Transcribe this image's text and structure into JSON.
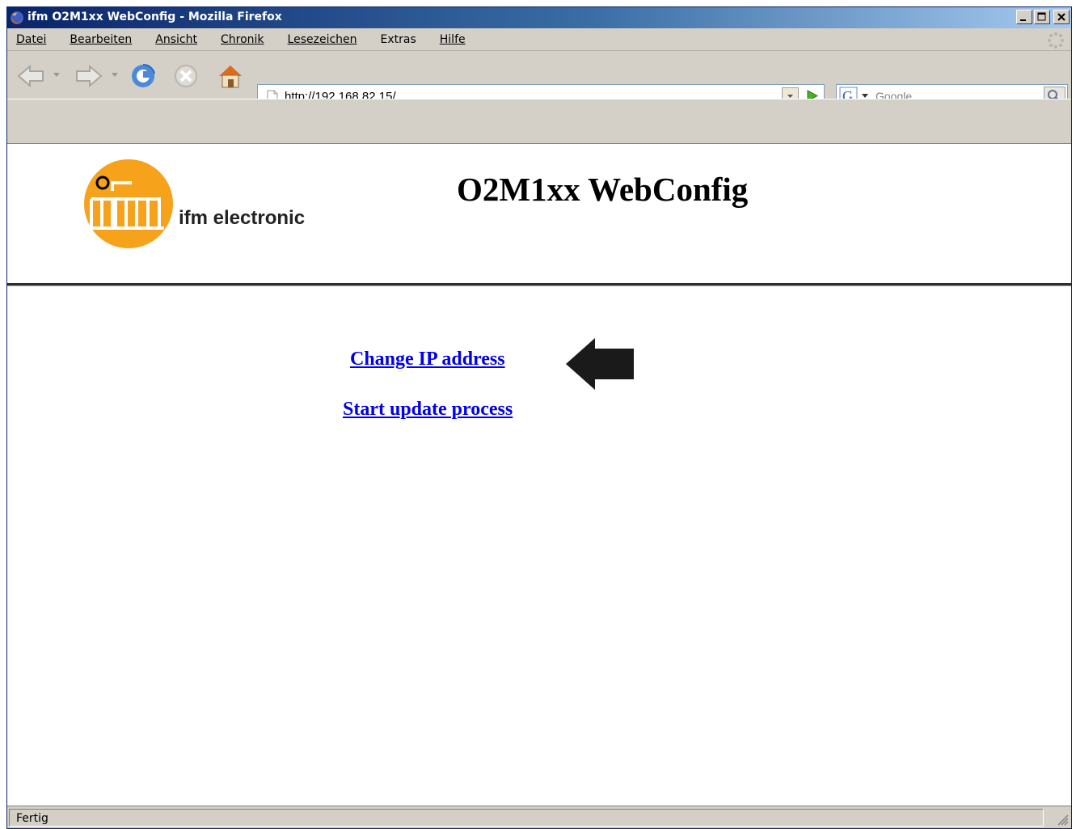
{
  "window": {
    "title": "ifm O2M1xx WebConfig - Mozilla Firefox",
    "controls": [
      "minimize-icon",
      "maximize-icon",
      "close-icon"
    ]
  },
  "menu": {
    "items": [
      {
        "label": "Datei",
        "accel": "D"
      },
      {
        "label": "Bearbeiten",
        "accel": "B"
      },
      {
        "label": "Ansicht",
        "accel": "A"
      },
      {
        "label": "Chronik",
        "accel": "C"
      },
      {
        "label": "Lesezeichen",
        "accel": "L"
      },
      {
        "label": "Extras",
        "accel": "x"
      },
      {
        "label": "Hilfe",
        "accel": "H"
      }
    ]
  },
  "navigation": {
    "url": "http://192.168.82.15/",
    "search_placeholder": "Google",
    "icons": [
      "back-icon",
      "forward-icon",
      "reload-icon",
      "stop-icon",
      "home-icon"
    ]
  },
  "page": {
    "brand": "ifm electronic",
    "title": "O2M1xx WebConfig",
    "links": {
      "change_ip": "Change IP address",
      "start_update": "Start update process"
    }
  },
  "status": {
    "text": "Fertig"
  },
  "colors": {
    "titlebar": "#0a246a",
    "link": "#0000ee",
    "logo_orange": "#f7a21b",
    "chrome": "#d4d0c8"
  }
}
